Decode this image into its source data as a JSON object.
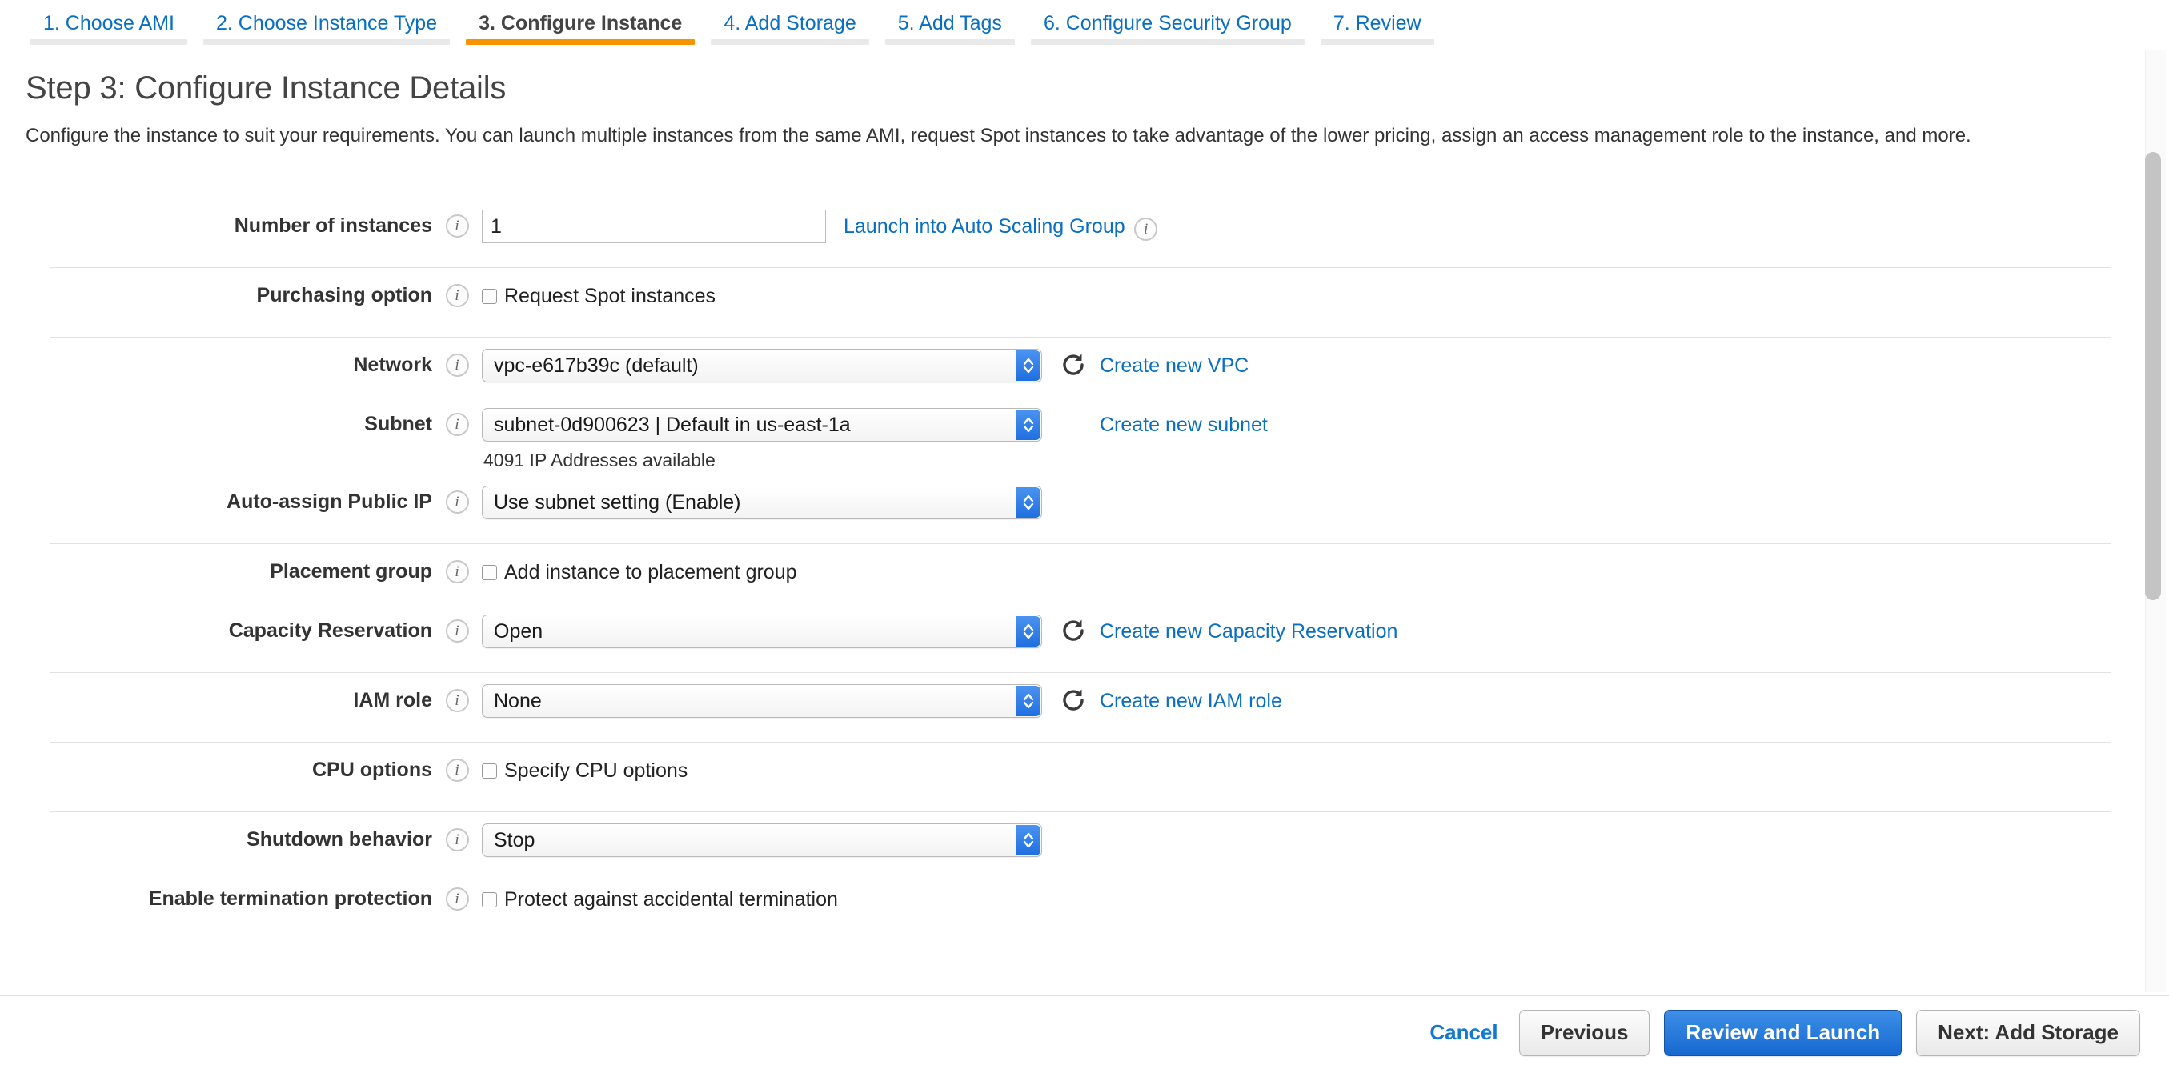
{
  "wizard": {
    "tabs": [
      {
        "label": "1. Choose AMI",
        "active": false
      },
      {
        "label": "2. Choose Instance Type",
        "active": false
      },
      {
        "label": "3. Configure Instance",
        "active": true
      },
      {
        "label": "4. Add Storage",
        "active": false
      },
      {
        "label": "5. Add Tags",
        "active": false
      },
      {
        "label": "6. Configure Security Group",
        "active": false
      },
      {
        "label": "7. Review",
        "active": false
      }
    ],
    "active_tab_index": 2,
    "active_underline_color": "#f79400",
    "inactive_underline_color": "#e9e9e9",
    "link_color": "#0a6fc2"
  },
  "header": {
    "title": "Step 3: Configure Instance Details",
    "description": "Configure the instance to suit your requirements. You can launch multiple instances from the same AMI, request Spot instances to take advantage of the lower pricing, assign an access management role to the instance, and more."
  },
  "form": {
    "info_icon_glyph": "i",
    "number_of_instances": {
      "label": "Number of instances",
      "value": "1",
      "link": "Launch into Auto Scaling Group"
    },
    "purchasing_option": {
      "label": "Purchasing option",
      "checkbox_label": "Request Spot instances",
      "checked": false
    },
    "network": {
      "label": "Network",
      "value": "vpc-e617b39c (default)",
      "link": "Create new VPC"
    },
    "subnet": {
      "label": "Subnet",
      "value": "subnet-0d900623 | Default in us-east-1a",
      "link": "Create new subnet",
      "note": "4091 IP Addresses available"
    },
    "auto_assign_public_ip": {
      "label": "Auto-assign Public IP",
      "value": "Use subnet setting (Enable)"
    },
    "placement_group": {
      "label": "Placement group",
      "checkbox_label": "Add instance to placement group",
      "checked": false
    },
    "capacity_reservation": {
      "label": "Capacity Reservation",
      "value": "Open",
      "link": "Create new Capacity Reservation"
    },
    "iam_role": {
      "label": "IAM role",
      "value": "None",
      "link": "Create new IAM role"
    },
    "cpu_options": {
      "label": "CPU options",
      "checkbox_label": "Specify CPU options",
      "checked": false
    },
    "shutdown_behavior": {
      "label": "Shutdown behavior",
      "value": "Stop"
    },
    "termination_protection": {
      "label": "Enable termination protection",
      "checkbox_label": "Protect against accidental termination",
      "checked": false
    }
  },
  "footer": {
    "cancel_label": "Cancel",
    "previous_label": "Previous",
    "review_launch_label": "Review and Launch",
    "next_label": "Next: Add Storage",
    "primary_color": "#1668d0"
  }
}
